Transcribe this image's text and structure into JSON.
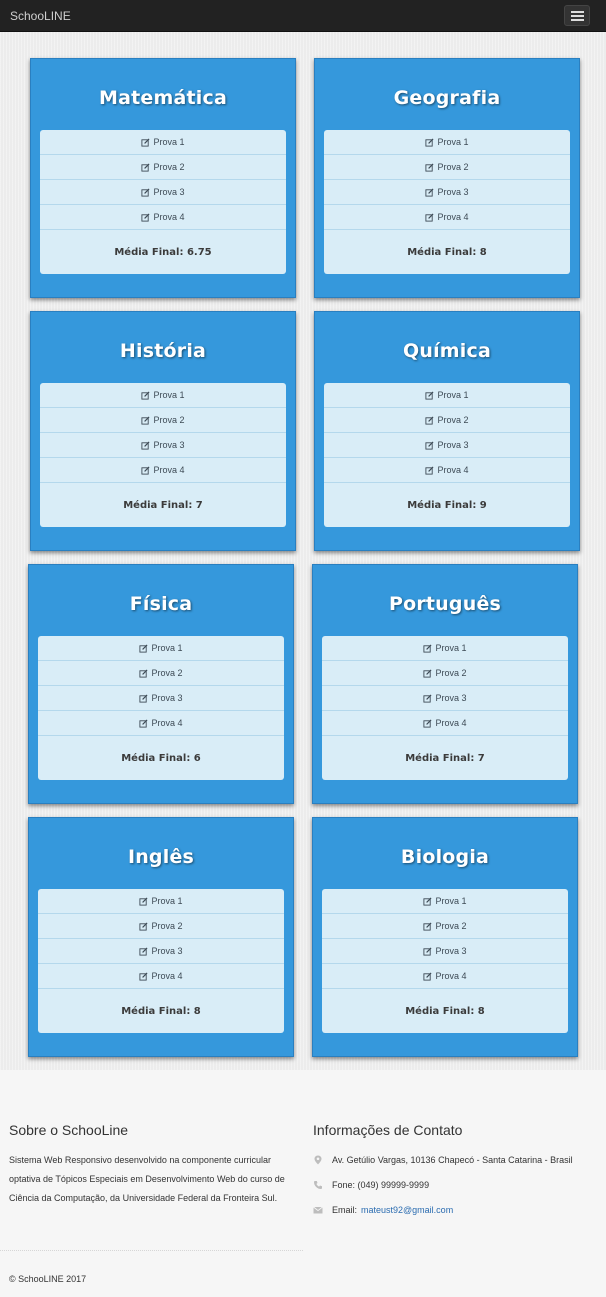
{
  "navbar": {
    "brand": "SchooLINE",
    "menu_icon": "hamburger-menu-icon"
  },
  "subjects": [
    {
      "title": "Matemática",
      "items": [
        "Prova 1",
        "Prova 2",
        "Prova 3",
        "Prova 4"
      ],
      "final": "Média Final: 6.75"
    },
    {
      "title": "Geografia",
      "items": [
        "Prova 1",
        "Prova 2",
        "Prova 3",
        "Prova 4"
      ],
      "final": "Média Final: 8"
    },
    {
      "title": "História",
      "items": [
        "Prova 1",
        "Prova 2",
        "Prova 3",
        "Prova 4"
      ],
      "final": "Média Final: 7"
    },
    {
      "title": "Química",
      "items": [
        "Prova 1",
        "Prova 2",
        "Prova 3",
        "Prova 4"
      ],
      "final": "Média Final: 9"
    },
    {
      "title": "Física",
      "items": [
        "Prova 1",
        "Prova 2",
        "Prova 3",
        "Prova 4"
      ],
      "final": "Média Final: 6"
    },
    {
      "title": "Português",
      "items": [
        "Prova 1",
        "Prova 2",
        "Prova 3",
        "Prova 4"
      ],
      "final": "Média Final: 7"
    },
    {
      "title": "Inglês",
      "items": [
        "Prova 1",
        "Prova 2",
        "Prova 3",
        "Prova 4"
      ],
      "final": "Média Final: 8"
    },
    {
      "title": "Biologia",
      "items": [
        "Prova 1",
        "Prova 2",
        "Prova 3",
        "Prova 4"
      ],
      "final": "Média Final: 8"
    }
  ],
  "footer": {
    "about_title": "Sobre o SchooLine",
    "about_text": "Sistema Web Responsivo desenvolvido na componente curricular optativa de Tópicos Especiais em Desenvolvimento Web do curso de Ciência da Computação, da Universidade Federal da Fronteira Sul.",
    "contact_title": "Informações de Contato",
    "address": "Av. Getúlio Vargas, 10136 Chapecó - Santa Catarina - Brasil",
    "phone": "Fone: (049) 99999-9999",
    "email_label": "Email:",
    "email": "mateust92@gmail.com",
    "copyright": "© SchooLINE 2017"
  },
  "colors": {
    "card": "#3598dc",
    "list": "#d9edf7",
    "navbar": "#222222",
    "link": "#2b6cb0"
  }
}
